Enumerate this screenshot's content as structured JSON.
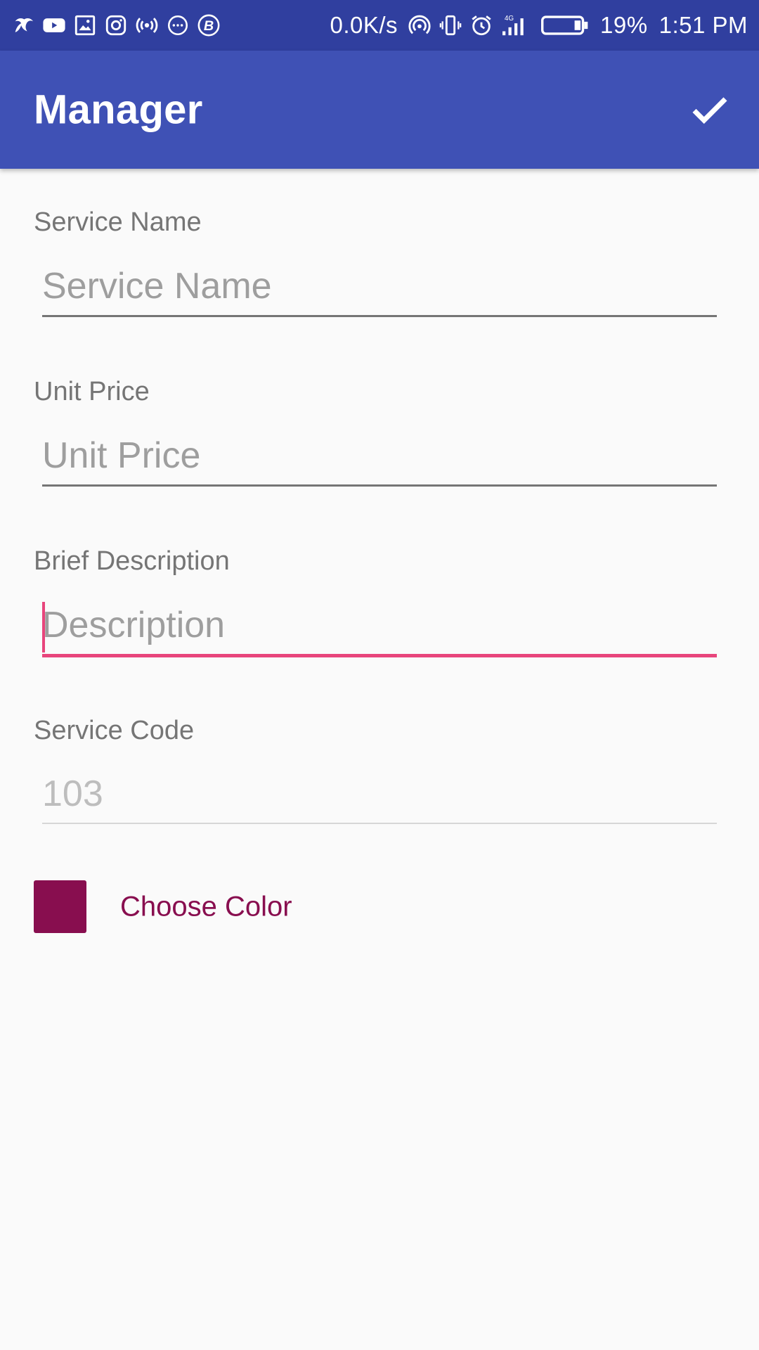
{
  "status_bar": {
    "left_icons": [
      "bird-app-icon",
      "youtube-icon",
      "gallery-icon",
      "instagram-icon",
      "broadcast-icon",
      "chat-bubble-icon",
      "b-circle-icon"
    ],
    "net_speed": "0.0K/s",
    "right_icons": [
      "hotspot-icon",
      "vibrate-icon",
      "alarm-icon",
      "signal-4g-icon",
      "battery-icon"
    ],
    "network_type": "4G",
    "battery_percent": "19%",
    "time": "1:51 PM"
  },
  "app_bar": {
    "title": "Manager",
    "confirm_icon": "check-icon"
  },
  "form": {
    "service_name": {
      "label": "Service Name",
      "placeholder": "Service Name",
      "value": ""
    },
    "unit_price": {
      "label": "Unit Price",
      "placeholder": "Unit Price",
      "value": ""
    },
    "description": {
      "label": "Brief Description",
      "placeholder": "Description",
      "value": "",
      "focused": true
    },
    "service_code": {
      "label": "Service Code",
      "placeholder": "103",
      "value": "",
      "disabled": true
    },
    "color": {
      "label": "Choose Color",
      "swatch_color": "#880e4f"
    }
  },
  "colors": {
    "status_bar": "#303f9f",
    "app_bar": "#3f51b5",
    "accent": "#e8457c",
    "label": "#757575",
    "background": "#fafafa"
  }
}
